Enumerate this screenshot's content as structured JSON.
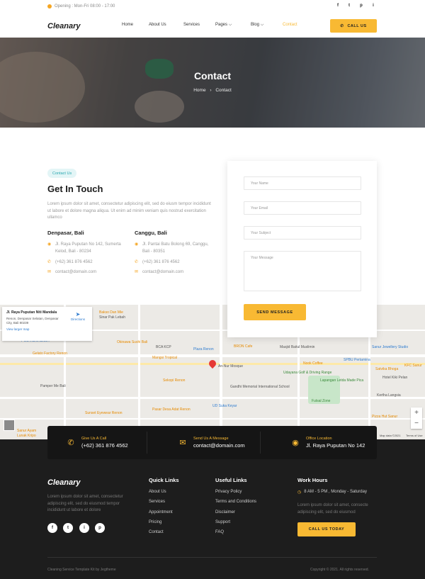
{
  "topbar": {
    "opening": "Opening : Mon-Fri 08:00 - 17:00",
    "social": [
      "f",
      "t",
      "p",
      "i"
    ]
  },
  "nav": {
    "logo": "Cleanary",
    "links": [
      "Home",
      "About Us",
      "Services",
      "Pages",
      "Blog",
      "Contact"
    ],
    "active": "Contact",
    "call_label": "CALL US"
  },
  "hero": {
    "title": "Contact",
    "crumb_home": "Home",
    "crumb_sep": "›",
    "crumb_current": "Contact"
  },
  "contact": {
    "tag": "Contact Us",
    "heading": "Get In Touch",
    "lead": "Lorem ipsum dolor sit amet, consectetur adipiscing elit, sed do eiusm tempor incididunt ut labore et dolore magna aliqua. Ut enim ad minim veniam quis nostrud exercitation ullamco",
    "offices": [
      {
        "city": "Denpasar, Bali",
        "address": "Jl. Raya Puputan No 142, Sumerta Kelod, Bali - 80234",
        "phone": "(+62) 361 876 4562",
        "email": "contact@domain.com"
      },
      {
        "city": "Canggu, Bali",
        "address": "Jl. Pantai Batu Bolong 69, Canggu, Bali - 80351",
        "phone": "(+62) 361 876 4562",
        "email": "contact@domain.com"
      }
    ]
  },
  "form": {
    "name_placeholder": "Your Name",
    "email_placeholder": "Your Email",
    "subject_placeholder": "Your Subject",
    "message_placeholder": "Your Message",
    "send_label": "SEND MESSAGE"
  },
  "map": {
    "card_title": "Jl. Raya Puputan Niti Mandala",
    "card_address": "Renon, Denpasar Selatan, Denpasar City, Bali 80239",
    "directions": "Directions",
    "larger": "View larger map",
    "places": [
      "Bakso Dan Mie",
      "Sinar Pak Lebah",
      "Okinawa Sushi Bali",
      "BCA KCP",
      "Gelato Factory Renon",
      "Mangsi Tropical",
      "Plaza Renon",
      "BRON Cafe",
      "Masjid Baitul Muslimin",
      "Sanur Jewellery Studio",
      "POS INDONESIA",
      "Pamper Me Bali",
      "Sekopi Renon",
      "An-Nur Mosque",
      "Gandhi Memorial International School",
      "Nook Coffee",
      "SPBU Pertamina",
      "Satvika Bhoga",
      "KFC Sanur",
      "Udayana Golf & Driving Range",
      "Lapangan Letda Made Pica",
      "Sunset Eyewear Renon",
      "Pasar Desa Adat Renon",
      "UD Suka Keyar",
      "Futsal Zone",
      "Pizza Hut Sanur",
      "Kertha Langsia",
      "Hotel Kiki Pelan",
      "Sanur Ayam",
      "Lunak Kripo"
    ],
    "map_data": "Map data ©2021",
    "terms": "Terms of Use",
    "zoom_in": "+",
    "zoom_out": "−"
  },
  "infobar": [
    {
      "label": "Give Us A Call",
      "value": "(+62) 361 876 4562",
      "icon": "phone-icon"
    },
    {
      "label": "Send Us A Message",
      "value": "contact@domain.com",
      "icon": "envelope-icon"
    },
    {
      "label": "Office Location",
      "value": "Jl. Raya Puputan No 142",
      "icon": "location-pin-icon"
    }
  ],
  "footer": {
    "logo": "Cleanary",
    "desc": "Lorem ipsum dolor sit amet, consectetur adipiscing elit, sed do eiusmod tempor incididunt ut labore et dolore",
    "social": [
      "f",
      "t",
      "i",
      "p"
    ],
    "quick_title": "Quick Links",
    "quick": [
      "About Us",
      "Services",
      "Appointment",
      "Pricing",
      "Contact"
    ],
    "useful_title": "Useful Links",
    "useful": [
      "Privacy Policy",
      "Terms and Conditions",
      "Disclaimer",
      "Support",
      "FAQ"
    ],
    "hours_title": "Work Hours",
    "hours": "8 AM - 5 PM , Monday - Saturday",
    "hours_desc": "Lorem ipsum dolor sit amet, consecte adipiscing elit, sed do eiusmod",
    "call_today": "CALL US TODAY",
    "credit": "Cleaning Service Template Kit by Jegtheme",
    "copyright": "Copyright © 2021. All rights reserved."
  },
  "colors": {
    "accent": "#f8b933",
    "teal": "#2aa7b0",
    "dark": "#1d1d1d"
  }
}
